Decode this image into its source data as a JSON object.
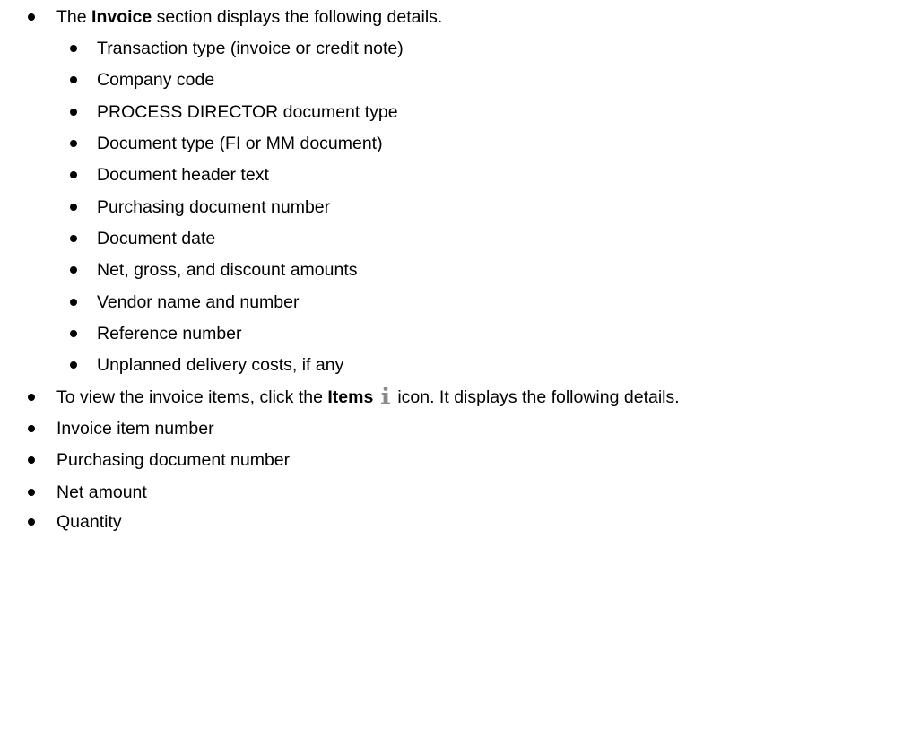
{
  "intro": {
    "prefix": "The ",
    "bold": "Invoice",
    "suffix": " section displays the following details."
  },
  "invoice_details": [
    "Transaction type (invoice or credit note)",
    "Company code",
    "PROCESS DIRECTOR document type",
    "Document type (FI or MM document)",
    "Document header text",
    "Purchasing document number",
    "Document date",
    "Net, gross, and discount amounts",
    "Vendor name and number",
    "Reference number",
    "Unplanned delivery costs, if any"
  ],
  "items_instruction": {
    "prefix": "To view the invoice items, click the ",
    "bold": "Items",
    "icon": "info-icon",
    "suffix": "icon. It displays the following details."
  },
  "item_details": [
    "Invoice item number",
    "Purchasing document number",
    "Net amount",
    "Quantity"
  ],
  "colors": {
    "text": "#000000",
    "icon": "#8a8a8a",
    "background": "#ffffff"
  }
}
